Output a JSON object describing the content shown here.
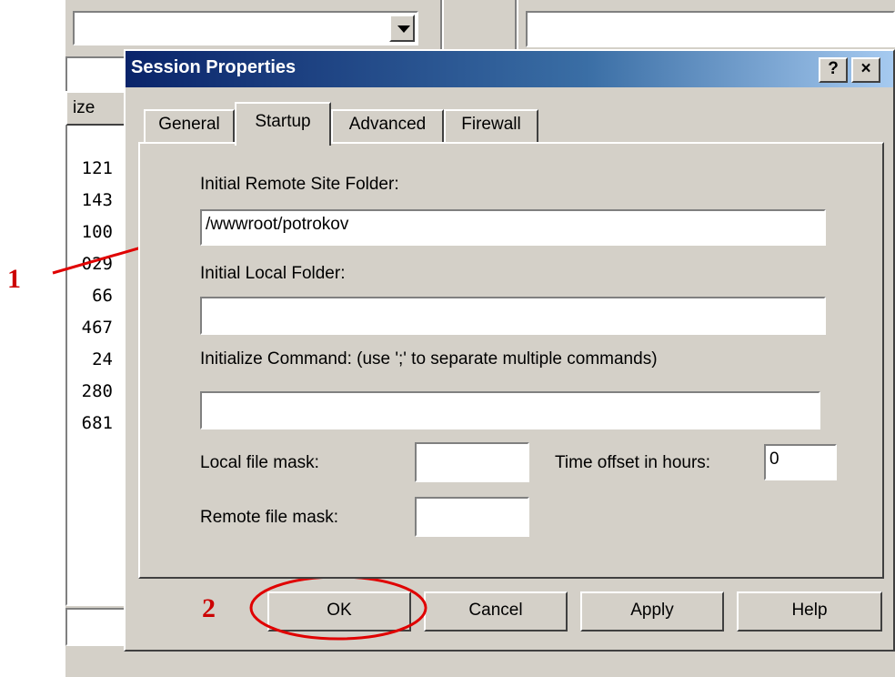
{
  "background": {
    "column_header": "ize",
    "sizes": [
      "121",
      "143",
      "100",
      "029",
      "66",
      "467",
      "24",
      "280",
      "681"
    ]
  },
  "dialog": {
    "title": "Session Properties",
    "help_button": "?",
    "close_button": "×",
    "tabs": [
      {
        "label": "General",
        "active": false
      },
      {
        "label": "Startup",
        "active": true
      },
      {
        "label": "Advanced",
        "active": false
      },
      {
        "label": "Firewall",
        "active": false
      }
    ],
    "startup": {
      "remote_folder_label": "Initial Remote Site Folder:",
      "remote_folder_value": "/wwwroot/potrokov",
      "local_folder_label": "Initial Local Folder:",
      "local_folder_value": "",
      "init_command_label": "Initialize Command: (use ';' to separate multiple commands)",
      "init_command_value": "",
      "local_mask_label": "Local file mask:",
      "local_mask_value": "",
      "time_offset_label": "Time offset in hours:",
      "time_offset_value": "0",
      "remote_mask_label": "Remote file mask:",
      "remote_mask_value": ""
    },
    "buttons": {
      "ok": "OK",
      "cancel": "Cancel",
      "apply": "Apply",
      "help": "Help"
    }
  },
  "annotations": {
    "marker_1": "1",
    "marker_2": "2",
    "color": "#cc0000"
  }
}
